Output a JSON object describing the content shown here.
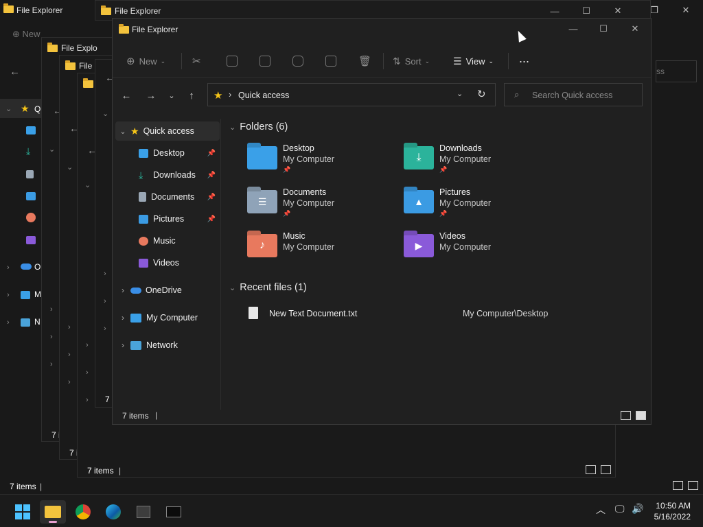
{
  "app_title": "File Explorer",
  "bg_windows": {
    "title_truncated_1": "File Explorer",
    "title_truncated_2": "File Explo",
    "title_truncated_3": "File E",
    "new_label": "New",
    "search_hint": "ss",
    "item_prefix_q": "Q",
    "item_prefix_o": "O",
    "item_prefix_m": "M",
    "item_prefix_n": "N",
    "status_small": "7 i",
    "status_full": "7 items"
  },
  "toolbar": {
    "new_label": "New",
    "sort_label": "Sort",
    "view_label": "View",
    "more_label": "..."
  },
  "address": {
    "location": "Quick access",
    "search_placeholder": "Search Quick access"
  },
  "navpane": {
    "items": [
      {
        "label": "Quick access"
      },
      {
        "label": "Desktop"
      },
      {
        "label": "Downloads"
      },
      {
        "label": "Documents"
      },
      {
        "label": "Pictures"
      },
      {
        "label": "Music"
      },
      {
        "label": "Videos"
      },
      {
        "label": "OneDrive"
      },
      {
        "label": "My Computer"
      },
      {
        "label": "Network"
      }
    ]
  },
  "content": {
    "folders_header": "Folders (6)",
    "folders": [
      {
        "name": "Desktop",
        "location": "My Computer",
        "color": "#3aa0e8"
      },
      {
        "name": "Downloads",
        "location": "My Computer",
        "color": "#2bb39b"
      },
      {
        "name": "Documents",
        "location": "My Computer",
        "color": "#8fa3b8"
      },
      {
        "name": "Pictures",
        "location": "My Computer",
        "color": "#3b9be3"
      },
      {
        "name": "Music",
        "location": "My Computer",
        "color": "#e8795e"
      },
      {
        "name": "Videos",
        "location": "My Computer",
        "color": "#8a5ad9"
      }
    ],
    "recent_header": "Recent files (1)",
    "recent": [
      {
        "name": "New Text Document.txt",
        "path": "My Computer\\Desktop"
      }
    ]
  },
  "status": {
    "items": "7 items"
  },
  "taskbar": {
    "time": "10:50 AM",
    "date": "5/16/2022"
  }
}
